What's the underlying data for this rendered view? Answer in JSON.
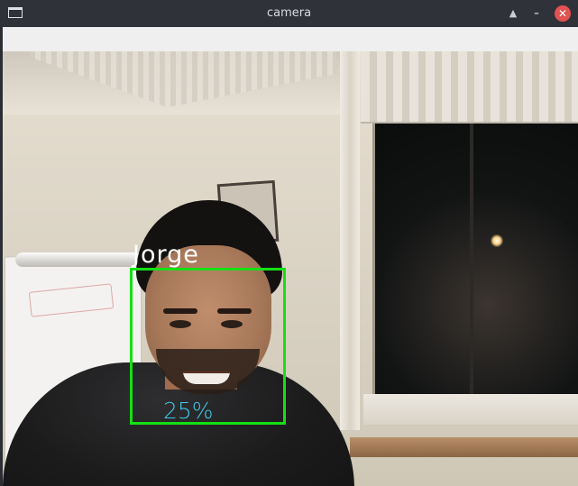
{
  "window": {
    "title": "camera",
    "buttons": {
      "keep_above_icon": "▲",
      "minimize_icon": "–",
      "close_icon": "✕"
    }
  },
  "detection": {
    "name": "Jorge",
    "confidence": "25%",
    "box_color": "#14e014",
    "name_color": "#ffffff",
    "confidence_color": "#40c8e8"
  }
}
